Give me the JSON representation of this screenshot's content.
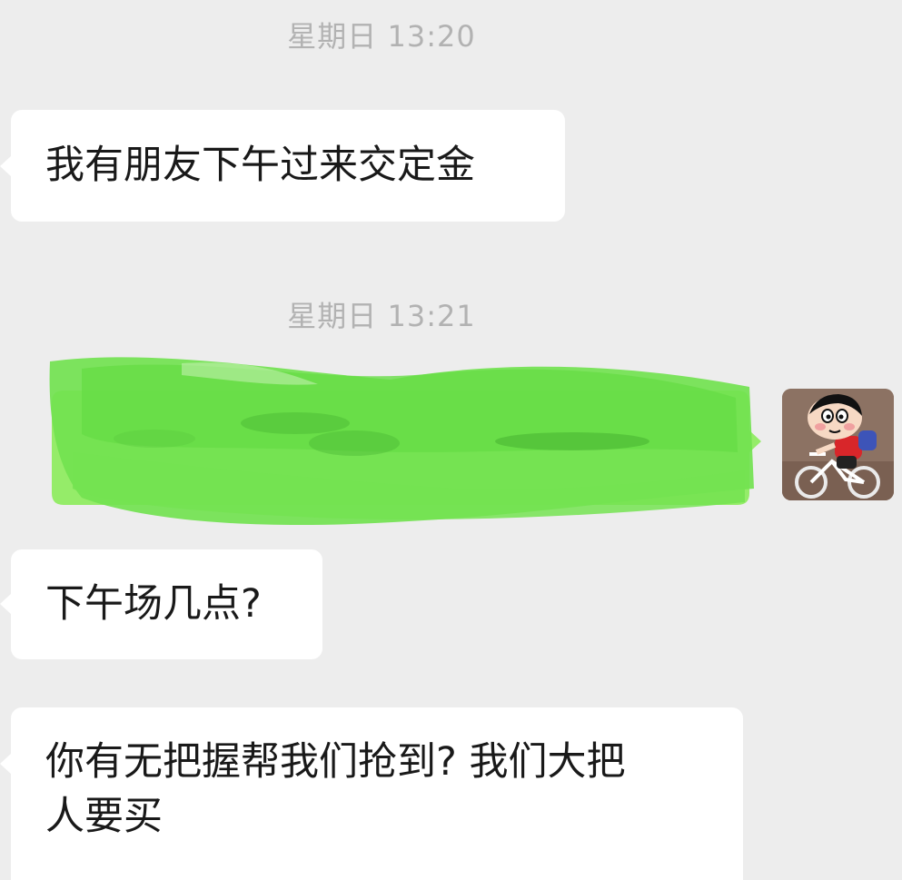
{
  "conversation": {
    "timestamps": [
      {
        "text": "星期日 13:20"
      },
      {
        "text": "星期日 13:21"
      }
    ],
    "messages": [
      {
        "sender": "contact",
        "text": "我有朋友下午过来交定金"
      },
      {
        "sender": "self",
        "text": "",
        "redacted": true,
        "bubble_color": "#95ec69",
        "scribble_color": "#6ee24d"
      },
      {
        "sender": "contact",
        "text": "下午场几点?"
      },
      {
        "sender": "contact",
        "text": "你有无把握帮我们抢到? 我们大把\n人要买"
      }
    ]
  },
  "colors": {
    "background": "#ededed",
    "incoming_bubble": "#ffffff",
    "outgoing_bubble": "#95ec69",
    "timestamp_text": "#b2b2b2",
    "message_text": "#191919"
  },
  "avatar": {
    "icon": "cartoon-boy-on-bicycle-icon"
  }
}
